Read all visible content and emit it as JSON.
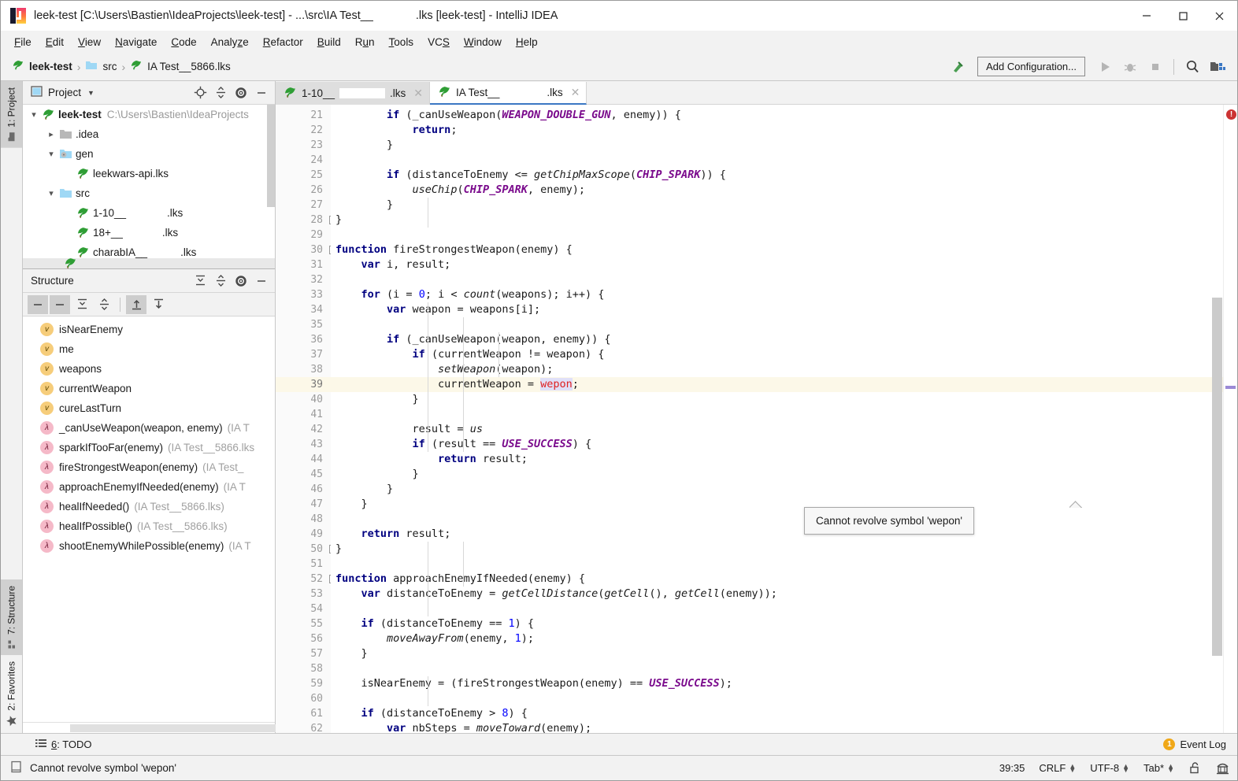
{
  "window": {
    "title_prefix": "leek-test [C:\\Users\\Bastien\\IdeaProjects\\leek-test] - ...\\src\\IA Test__",
    "title_suffix": ".lks [leek-test] - IntelliJ IDEA",
    "minimize": "minimize-icon",
    "maximize": "maximize-icon",
    "close": "close-icon"
  },
  "menubar": {
    "items": [
      {
        "label": "File",
        "mnemonic": "F"
      },
      {
        "label": "Edit",
        "mnemonic": "E"
      },
      {
        "label": "View",
        "mnemonic": "V"
      },
      {
        "label": "Navigate",
        "mnemonic": "N"
      },
      {
        "label": "Code",
        "mnemonic": "C"
      },
      {
        "label": "Analyze",
        "mnemonic": "z"
      },
      {
        "label": "Refactor",
        "mnemonic": "R"
      },
      {
        "label": "Build",
        "mnemonic": "B"
      },
      {
        "label": "Run",
        "mnemonic": "u"
      },
      {
        "label": "Tools",
        "mnemonic": "T"
      },
      {
        "label": "VCS",
        "mnemonic": "S"
      },
      {
        "label": "Window",
        "mnemonic": "W"
      },
      {
        "label": "Help",
        "mnemonic": "H"
      }
    ]
  },
  "navbar": {
    "breadcrumbs": [
      "leek-test",
      "src",
      "IA Test__5866.lks"
    ],
    "add_configuration": "Add Configuration...",
    "icons": [
      "build-hammer-icon",
      "run-icon",
      "debug-icon",
      "stop-icon",
      "search-everywhere-icon",
      "project-structure-icon"
    ]
  },
  "left_strip": {
    "top": [
      {
        "num": "1",
        "label": "1: Project",
        "icon": "folder-icon",
        "active": true
      }
    ],
    "bottom": [
      {
        "num": "7",
        "label": "7: Structure",
        "icon": "structure-icon",
        "active": true
      },
      {
        "num": "2",
        "label": "2: Favorites",
        "icon": "star-icon",
        "active": false
      }
    ]
  },
  "project_panel": {
    "title": "Project",
    "dropdown": "chevron-down-icon",
    "toolbar_icons": [
      "locate-icon",
      "collapse-all-icon",
      "settings-gear-icon",
      "hide-icon"
    ],
    "tree": [
      {
        "depth": 0,
        "arrow": "expanded",
        "icon": "leek-icon",
        "label": "leek-test",
        "bold": true,
        "path": "C:\\Users\\Bastien\\IdeaProjects",
        "redact": 0
      },
      {
        "depth": 1,
        "arrow": "collapsed",
        "icon": "folder-icon",
        "label": ".idea",
        "bold": false,
        "path": "",
        "redact": 0
      },
      {
        "depth": 1,
        "arrow": "expanded",
        "icon": "folder-gen-icon",
        "label": "gen",
        "bold": false,
        "path": "",
        "redact": 0
      },
      {
        "depth": 2,
        "arrow": "none",
        "icon": "leek-icon",
        "label": "leekwars-api.lks",
        "bold": false,
        "path": "",
        "redact": 0
      },
      {
        "depth": 1,
        "arrow": "expanded",
        "icon": "folder-icon",
        "label": "src",
        "bold": false,
        "path": "",
        "redact": 0
      },
      {
        "depth": 2,
        "arrow": "none",
        "icon": "leek-icon",
        "label": "1-10__",
        "suffix": ".lks",
        "bold": false,
        "path": "",
        "redact": 52
      },
      {
        "depth": 2,
        "arrow": "none",
        "icon": "leek-icon",
        "label": "18+__",
        "suffix": ".lks",
        "bold": false,
        "path": "",
        "redact": 50
      },
      {
        "depth": 2,
        "arrow": "none",
        "icon": "leek-icon",
        "label": "charabIA__",
        "suffix": ".lks",
        "bold": false,
        "path": "",
        "redact": 42
      }
    ]
  },
  "structure_panel": {
    "title": "Structure",
    "header_icons": [
      "expand-all-icon",
      "collapse-all-icon",
      "settings-gear-icon",
      "hide-icon"
    ],
    "toolbar_icons": [
      "sort-alpha-icon",
      "sort-visibility-icon",
      "expand-all-icon",
      "collapse-all-icon",
      "scroll-from-source-icon",
      "scroll-to-source-icon"
    ],
    "items": [
      {
        "kind": "v",
        "label": "isNearEnemy",
        "file": ""
      },
      {
        "kind": "v",
        "label": "me",
        "file": ""
      },
      {
        "kind": "v",
        "label": "weapons",
        "file": ""
      },
      {
        "kind": "v",
        "label": "currentWeapon",
        "file": ""
      },
      {
        "kind": "v",
        "label": "cureLastTurn",
        "file": ""
      },
      {
        "kind": "f",
        "label": "_canUseWeapon(weapon, enemy)",
        "file": "(IA T"
      },
      {
        "kind": "f",
        "label": "sparkIfTooFar(enemy)",
        "file": "(IA Test__5866.lks"
      },
      {
        "kind": "f",
        "label": "fireStrongestWeapon(enemy)",
        "file": "(IA Test_"
      },
      {
        "kind": "f",
        "label": "approachEnemyIfNeeded(enemy)",
        "file": "(IA T"
      },
      {
        "kind": "f",
        "label": "healIfNeeded()",
        "file": "(IA Test__5866.lks)"
      },
      {
        "kind": "f",
        "label": "healIfPossible()",
        "file": "(IA Test__5866.lks)"
      },
      {
        "kind": "f",
        "label": "shootEnemyWhilePossible(enemy)",
        "file": "(IA T"
      }
    ]
  },
  "editor": {
    "tabs": [
      {
        "label_prefix": "1-10__",
        "label_suffix": ".lks",
        "redact": 58,
        "icon": "leek-icon",
        "active": false,
        "close": "close-icon"
      },
      {
        "label_prefix": "IA Test__",
        "label_suffix": ".lks",
        "redact": 48,
        "icon": "leek-icon",
        "active": true,
        "close": "close-icon"
      }
    ],
    "first_line": 21,
    "current_line": 39,
    "error_icon": "error-circle-icon",
    "lines": [
      {
        "n": 21,
        "segments": [
          {
            "t": "        "
          },
          {
            "t": "if",
            "c": "kw"
          },
          {
            "t": " (_canUseWeapon("
          },
          {
            "t": "WEAPON_DOUBLE_GUN",
            "c": "cst"
          },
          {
            "t": ", enemy)) {"
          }
        ]
      },
      {
        "n": 22,
        "segments": [
          {
            "t": "            "
          },
          {
            "t": "return",
            "c": "kw"
          },
          {
            "t": ";"
          }
        ]
      },
      {
        "n": 23,
        "segments": [
          {
            "t": "        }"
          }
        ]
      },
      {
        "n": 24,
        "segments": [
          {
            "t": ""
          }
        ]
      },
      {
        "n": 25,
        "segments": [
          {
            "t": "        "
          },
          {
            "t": "if",
            "c": "kw"
          },
          {
            "t": " (distanceToEnemy <= "
          },
          {
            "t": "getChipMaxScope",
            "c": "fnc"
          },
          {
            "t": "("
          },
          {
            "t": "CHIP_SPARK",
            "c": "cst"
          },
          {
            "t": ")) {"
          }
        ]
      },
      {
        "n": 26,
        "segments": [
          {
            "t": "            "
          },
          {
            "t": "useChip",
            "c": "fnc"
          },
          {
            "t": "("
          },
          {
            "t": "CHIP_SPARK",
            "c": "cst"
          },
          {
            "t": ", enemy);"
          }
        ]
      },
      {
        "n": 27,
        "segments": [
          {
            "t": "        }"
          }
        ]
      },
      {
        "n": 28,
        "segments": [
          {
            "t": "}"
          }
        ],
        "fold": "collapse"
      },
      {
        "n": 29,
        "segments": [
          {
            "t": ""
          }
        ]
      },
      {
        "n": 30,
        "segments": [
          {
            "t": "function",
            "c": "kw"
          },
          {
            "t": " fireStrongestWeapon(enemy) {"
          }
        ],
        "fold": "collapse"
      },
      {
        "n": 31,
        "segments": [
          {
            "t": "    "
          },
          {
            "t": "var",
            "c": "kw"
          },
          {
            "t": " i, result;"
          }
        ]
      },
      {
        "n": 32,
        "segments": [
          {
            "t": ""
          }
        ]
      },
      {
        "n": 33,
        "segments": [
          {
            "t": "    "
          },
          {
            "t": "for",
            "c": "kw"
          },
          {
            "t": " (i = "
          },
          {
            "t": "0",
            "c": "num"
          },
          {
            "t": "; i < "
          },
          {
            "t": "count",
            "c": "fnc"
          },
          {
            "t": "(weapons); i++) {"
          }
        ]
      },
      {
        "n": 34,
        "segments": [
          {
            "t": "        "
          },
          {
            "t": "var",
            "c": "kw"
          },
          {
            "t": " weapon = weapons[i];"
          }
        ]
      },
      {
        "n": 35,
        "segments": [
          {
            "t": ""
          }
        ]
      },
      {
        "n": 36,
        "segments": [
          {
            "t": "        "
          },
          {
            "t": "if",
            "c": "kw"
          },
          {
            "t": " (_canUseWeapon(weapon, enemy)) {"
          }
        ]
      },
      {
        "n": 37,
        "segments": [
          {
            "t": "            "
          },
          {
            "t": "if",
            "c": "kw"
          },
          {
            "t": " (currentWeapon != weapon) {"
          }
        ]
      },
      {
        "n": 38,
        "segments": [
          {
            "t": "                "
          },
          {
            "t": "setWeapon",
            "c": "fnc"
          },
          {
            "t": "(weapon);"
          }
        ]
      },
      {
        "n": 39,
        "segments": [
          {
            "t": "                currentWeapon = "
          },
          {
            "t": "wepon",
            "c": "err"
          },
          {
            "t": ";"
          }
        ],
        "current": true
      },
      {
        "n": 40,
        "segments": [
          {
            "t": "            }"
          }
        ]
      },
      {
        "n": 41,
        "segments": [
          {
            "t": ""
          }
        ]
      },
      {
        "n": 42,
        "segments": [
          {
            "t": "            result = "
          },
          {
            "t": "us",
            "c": "fnc"
          }
        ]
      },
      {
        "n": 43,
        "segments": [
          {
            "t": "            "
          },
          {
            "t": "if",
            "c": "kw"
          },
          {
            "t": " (result == "
          },
          {
            "t": "USE_SUCCESS",
            "c": "cst"
          },
          {
            "t": ") {"
          }
        ]
      },
      {
        "n": 44,
        "segments": [
          {
            "t": "                "
          },
          {
            "t": "return",
            "c": "kw"
          },
          {
            "t": " result;"
          }
        ]
      },
      {
        "n": 45,
        "segments": [
          {
            "t": "            }"
          }
        ]
      },
      {
        "n": 46,
        "segments": [
          {
            "t": "        }"
          }
        ]
      },
      {
        "n": 47,
        "segments": [
          {
            "t": "    }"
          }
        ]
      },
      {
        "n": 48,
        "segments": [
          {
            "t": ""
          }
        ]
      },
      {
        "n": 49,
        "segments": [
          {
            "t": "    "
          },
          {
            "t": "return",
            "c": "kw"
          },
          {
            "t": " result;"
          }
        ]
      },
      {
        "n": 50,
        "segments": [
          {
            "t": "}"
          }
        ],
        "fold": "collapse"
      },
      {
        "n": 51,
        "segments": [
          {
            "t": ""
          }
        ]
      },
      {
        "n": 52,
        "segments": [
          {
            "t": "function",
            "c": "kw"
          },
          {
            "t": " approachEnemyIfNeeded(enemy) {"
          }
        ],
        "fold": "collapse"
      },
      {
        "n": 53,
        "segments": [
          {
            "t": "    "
          },
          {
            "t": "var",
            "c": "kw"
          },
          {
            "t": " distanceToEnemy = "
          },
          {
            "t": "getCellDistance",
            "c": "fnc"
          },
          {
            "t": "("
          },
          {
            "t": "getCell",
            "c": "fnc"
          },
          {
            "t": "(), "
          },
          {
            "t": "getCell",
            "c": "fnc"
          },
          {
            "t": "(enemy));"
          }
        ]
      },
      {
        "n": 54,
        "segments": [
          {
            "t": ""
          }
        ]
      },
      {
        "n": 55,
        "segments": [
          {
            "t": "    "
          },
          {
            "t": "if",
            "c": "kw"
          },
          {
            "t": " (distanceToEnemy == "
          },
          {
            "t": "1",
            "c": "num"
          },
          {
            "t": ") {"
          }
        ]
      },
      {
        "n": 56,
        "segments": [
          {
            "t": "        "
          },
          {
            "t": "moveAwayFrom",
            "c": "fnc"
          },
          {
            "t": "(enemy, "
          },
          {
            "t": "1",
            "c": "num"
          },
          {
            "t": ");"
          }
        ]
      },
      {
        "n": 57,
        "segments": [
          {
            "t": "    }"
          }
        ]
      },
      {
        "n": 58,
        "segments": [
          {
            "t": ""
          }
        ]
      },
      {
        "n": 59,
        "segments": [
          {
            "t": "    isNearEnemy = (fireStrongestWeapon(enemy) == "
          },
          {
            "t": "USE_SUCCESS",
            "c": "cst"
          },
          {
            "t": ");"
          }
        ]
      },
      {
        "n": 60,
        "segments": [
          {
            "t": ""
          }
        ]
      },
      {
        "n": 61,
        "segments": [
          {
            "t": "    "
          },
          {
            "t": "if",
            "c": "kw"
          },
          {
            "t": " (distanceToEnemy > "
          },
          {
            "t": "8",
            "c": "num"
          },
          {
            "t": ") {"
          }
        ]
      },
      {
        "n": 62,
        "segments": [
          {
            "t": "        "
          },
          {
            "t": "var",
            "c": "kw"
          },
          {
            "t": " nbSteps = "
          },
          {
            "t": "moveToward",
            "c": "fnc"
          },
          {
            "t": "(enemy);"
          }
        ]
      }
    ],
    "tooltip": "Cannot revolve symbol 'wepon'"
  },
  "todobar": {
    "label": "6: TODO",
    "mnemonic": "6",
    "icon": "todo-list-icon",
    "event_log": "Event Log",
    "event_count": "1"
  },
  "statusbar": {
    "message": "Cannot revolve symbol 'wepon'",
    "message_icon": "editor-hint-icon",
    "caret": "39:35",
    "line_separator": "CRLF",
    "encoding": "UTF-8",
    "indent": "Tab*",
    "lock_icon": "unlocked-icon",
    "inspector_icon": "hector-inspector-icon"
  },
  "colors": {
    "accent": "#3b78c4",
    "error": "#e02020",
    "keyword": "#000080",
    "constant": "#7a0a8c",
    "number": "#0000ff",
    "current_line": "#fcf8e8",
    "error_stripe": "#cc3333",
    "badge": "#f0a818"
  }
}
